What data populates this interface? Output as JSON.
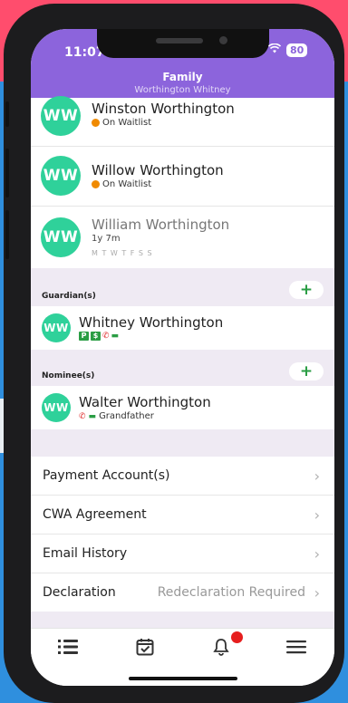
{
  "status_bar": {
    "time": "11:07",
    "battery": "80"
  },
  "header": {
    "title": "Family",
    "subtitle": "Worthington Whitney"
  },
  "children": [
    {
      "initials": "WW",
      "name": "Winston Worthington",
      "status": "On Waitlist"
    },
    {
      "initials": "WW",
      "name": "Willow Worthington",
      "status": "On Waitlist"
    },
    {
      "initials": "WW",
      "name": "William Worthington",
      "age": "1y 7m",
      "days": "M T W T F S S"
    }
  ],
  "guardians": {
    "label": "Guardian(s)",
    "add_label": "+",
    "items": [
      {
        "initials": "WW",
        "name": "Whitney Worthington",
        "badges": [
          "P",
          "$"
        ]
      }
    ]
  },
  "nominees": {
    "label": "Nominee(s)",
    "add_label": "+",
    "items": [
      {
        "initials": "WW",
        "name": "Walter Worthington",
        "relation": "Grandfather"
      }
    ]
  },
  "menu": [
    {
      "label": "Payment Account(s)",
      "value": ""
    },
    {
      "label": "CWA Agreement",
      "value": ""
    },
    {
      "label": "Email History",
      "value": ""
    },
    {
      "label": "Declaration",
      "value": "Redeclaration Required"
    }
  ],
  "tabbar": {
    "tabs": [
      "list-icon",
      "calendar-check-icon",
      "bell-icon",
      "menu-icon"
    ],
    "notification_dot_color": "#e61e1e"
  },
  "colors": {
    "header": "#8c64dc",
    "avatar": "#2fd19a",
    "add": "#2a9d44",
    "section_bg": "#efeaf3"
  }
}
